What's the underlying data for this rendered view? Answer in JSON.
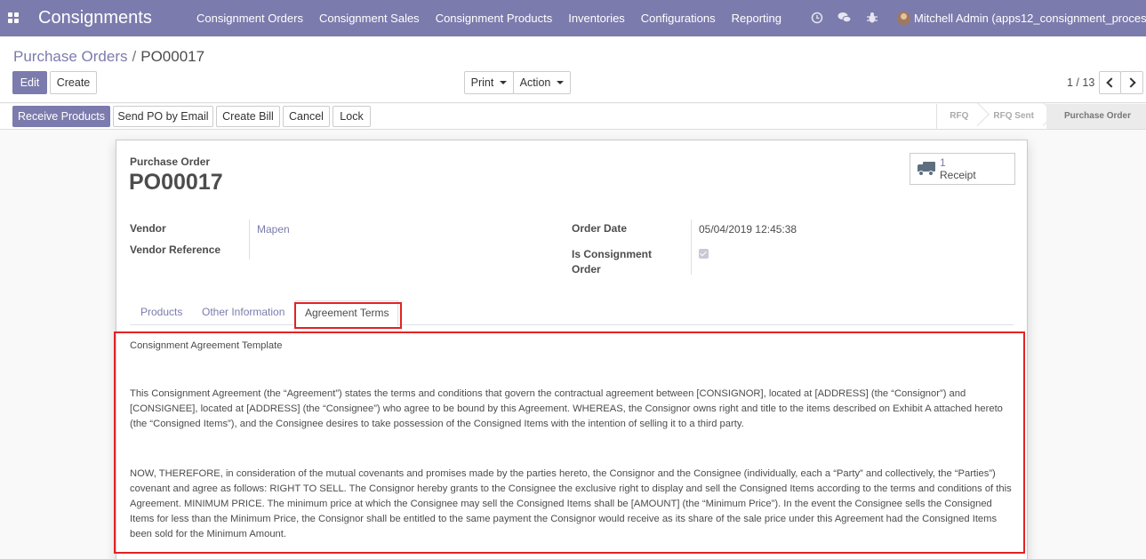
{
  "navbar": {
    "app_name": "Consignments",
    "menu": [
      "Consignment Orders",
      "Consignment Sales",
      "Consignment Products",
      "Inventories",
      "Configurations",
      "Reporting"
    ],
    "user": "Mitchell Admin (apps12_consignment_process)"
  },
  "breadcrumb": {
    "parent": "Purchase Orders",
    "separator": "/",
    "current": "PO00017"
  },
  "toolbar": {
    "edit": "Edit",
    "create": "Create",
    "print": "Print",
    "action": "Action"
  },
  "pager": {
    "text": "1 / 13"
  },
  "statusbar": {
    "buttons": [
      "Receive Products",
      "Send PO by Email",
      "Create Bill",
      "Cancel",
      "Lock"
    ],
    "stages": [
      "RFQ",
      "RFQ Sent",
      "Purchase Order"
    ],
    "active_stage": "Purchase Order"
  },
  "smart_button": {
    "count": "1",
    "label": "Receipt"
  },
  "form": {
    "title_label": "Purchase Order",
    "name": "PO00017",
    "vendor_label": "Vendor",
    "vendor_value": "Mapen",
    "vendor_ref_label": "Vendor Reference",
    "order_date_label": "Order Date",
    "order_date_value": "05/04/2019 12:45:38",
    "consignment_label_1": "Is Consignment",
    "consignment_label_2": "Order",
    "is_consignment": true
  },
  "tabs": [
    "Products",
    "Other Information",
    "Agreement Terms"
  ],
  "active_tab": "Agreement Terms",
  "agreement": {
    "heading": "Consignment Agreement Template",
    "para1": "This Consignment Agreement (the “Agreement”) states the terms and conditions that govern the contractual agreement between [CONSIGNOR], located at [ADDRESS] (the “Consignor”) and [CONSIGNEE], located at [ADDRESS] (the “Consignee”) who agree to be bound by this Agreement. WHEREAS, the Consignor owns right and title to the items described on Exhibit A attached hereto (the “Consigned Items”), and the Consignee desires to take possession of the Consigned Items with the intention of selling it to a third party.",
    "para2": "NOW, THEREFORE, in consideration of the mutual covenants and promises made by the parties hereto, the Consignor and the Consignee (individually, each a “Party” and collectively, the “Parties”) covenant and agree as follows: RIGHT TO SELL. The Consignor hereby grants to the Consignee the exclusive right to display and sell the Consigned Items according to the terms and conditions of this Agreement. MINIMUM PRICE. The minimum price at which the Consignee may sell the Consigned Items shall be [AMOUNT] (the “Minimum Price”). In the event the Consignee sells the Consigned Items for less than the Minimum Price, the Consignor shall be entitled to the same payment the Consignor would receive as its share of the sale price under this Agreement had the Consigned Items been sold for the Minimum Amount."
  },
  "colors": {
    "brand": "#7c7bad",
    "highlight": "#e32222"
  }
}
